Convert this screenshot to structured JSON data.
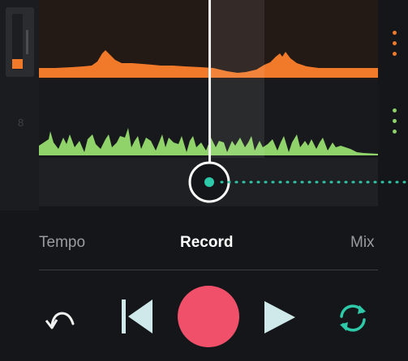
{
  "track": {
    "number": "8"
  },
  "colors": {
    "background": "#141619",
    "audio_wave": "#f07a2a",
    "midi_wave": "#8fd36a",
    "accent_teal": "#2ec9a8",
    "record": "#f0506a",
    "active_text": "#ffffff",
    "inactive_text": "#9a9ca2"
  },
  "modes": {
    "tempo_label": "Tempo",
    "record_label": "Record",
    "mix_label": "Mix",
    "selected": "Record"
  },
  "transport": {
    "undo_icon": "undo-arrow-icon",
    "back_icon": "skip-back-icon",
    "record_icon": "record-circle-icon",
    "play_icon": "play-icon",
    "loop_icon": "loop-icon"
  }
}
